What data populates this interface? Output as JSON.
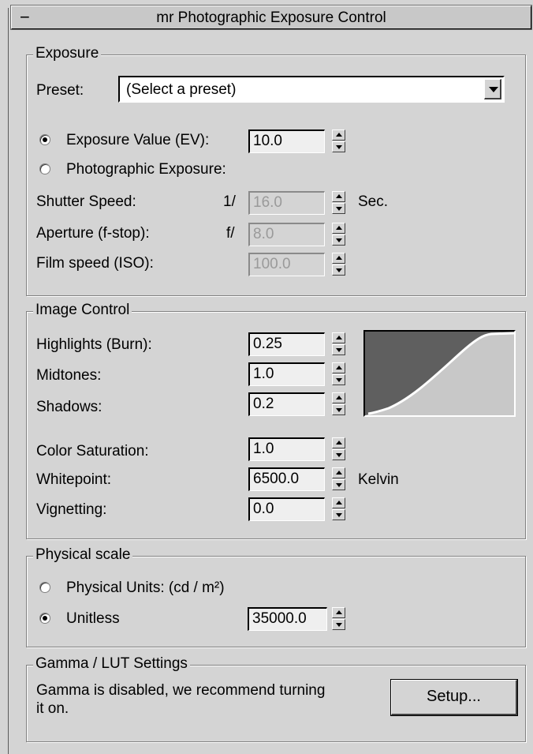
{
  "rollout": {
    "collapse_symbol": "−",
    "title": "mr Photographic Exposure Control"
  },
  "exposure": {
    "legend": "Exposure",
    "preset_label": "Preset:",
    "preset_value": "(Select a preset)",
    "ev_label": "Exposure Value (EV):",
    "ev_value": "10.0",
    "ev_selected": true,
    "photo_label": "Photographic Exposure:",
    "photo_selected": false,
    "shutter_label": "Shutter Speed:",
    "shutter_prefix": "1/",
    "shutter_value": "16.0",
    "shutter_unit": "Sec.",
    "aperture_label": "Aperture (f-stop):",
    "aperture_prefix": "f/",
    "aperture_value": "8.0",
    "iso_label": "Film speed (ISO):",
    "iso_value": "100.0"
  },
  "image_control": {
    "legend": "Image Control",
    "highlights_label": "Highlights (Burn):",
    "highlights_value": "0.25",
    "midtones_label": "Midtones:",
    "midtones_value": "1.0",
    "shadows_label": "Shadows:",
    "shadows_value": "0.2",
    "saturation_label": "Color Saturation:",
    "saturation_value": "1.0",
    "whitepoint_label": "Whitepoint:",
    "whitepoint_value": "6500.0",
    "whitepoint_unit": "Kelvin",
    "vignetting_label": "Vignetting:",
    "vignetting_value": "0.0"
  },
  "physical_scale": {
    "legend": "Physical scale",
    "units_label": "Physical Units: (cd / m²)",
    "units_selected": false,
    "unitless_label": "Unitless",
    "unitless_selected": true,
    "unitless_value": "35000.0"
  },
  "gamma": {
    "legend": "Gamma / LUT Settings",
    "message_line1": "Gamma is disabled, we recommend turning",
    "message_line2": "it on.",
    "setup_label": "Setup..."
  },
  "colors": {
    "panel": "#d4d4d4",
    "curve_dark": "#5f5f5f",
    "curve_line": "#ffffff"
  }
}
